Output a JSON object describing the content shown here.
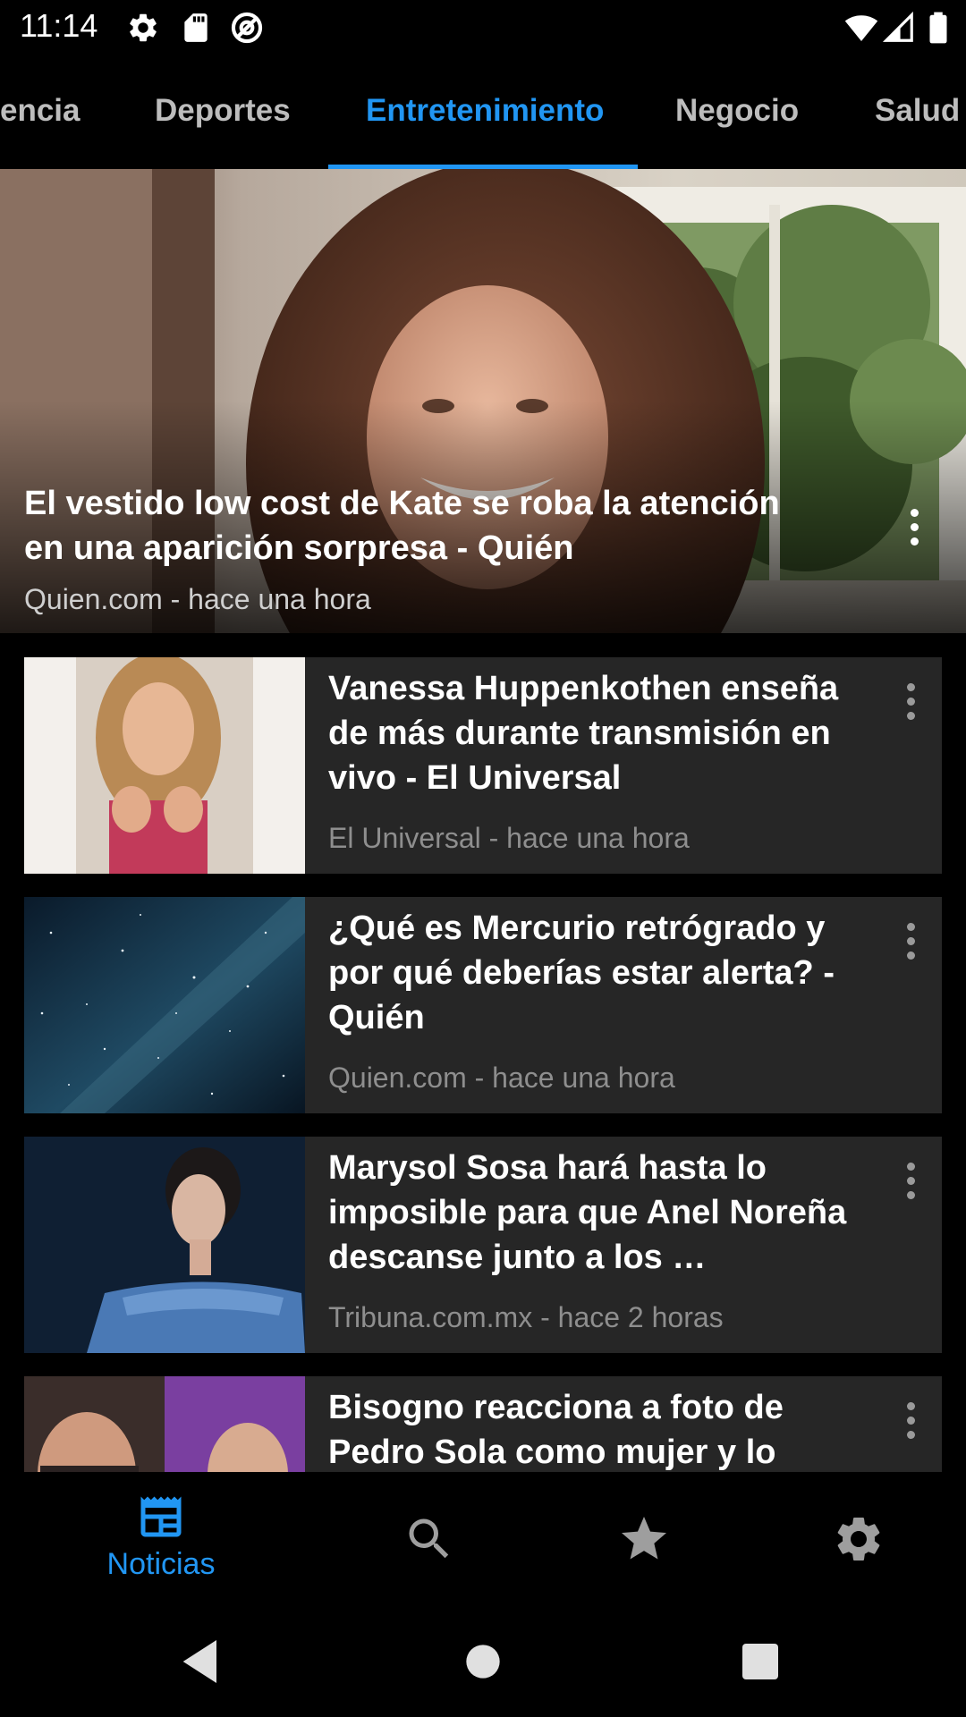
{
  "status_bar": {
    "time": "11:14",
    "icons": [
      "settings-gear-icon",
      "sd-card-icon",
      "at-sign-icon",
      "wifi-icon",
      "signal-icon",
      "battery-icon"
    ]
  },
  "tabs": [
    {
      "label": "encia",
      "active": false
    },
    {
      "label": "Deportes",
      "active": false
    },
    {
      "label": "Entretenimiento",
      "active": true
    },
    {
      "label": "Negocio",
      "active": false
    },
    {
      "label": "Salud",
      "active": false
    }
  ],
  "featured": {
    "title": "El vestido low cost de Kate se roba la atención en una aparición sorpresa - Quién",
    "meta": "Quien.com - hace una hora"
  },
  "articles": [
    {
      "title": "Vanessa Huppenkothen enseña de más durante transmisión en vivo - El Universal",
      "meta": "El Universal - hace una hora"
    },
    {
      "title": "¿Qué es Mercurio retrógrado y por qué deberías estar alerta? - Quién",
      "meta": "Quien.com - hace una hora"
    },
    {
      "title": "Marysol Sosa hará hasta lo imposible para que Anel Noreña descanse junto a los …",
      "meta": "Tribuna.com.mx - hace 2 horas"
    },
    {
      "title": "Bisogno reacciona a foto de Pedro Sola como mujer y lo",
      "meta": ""
    }
  ],
  "bottom_nav": {
    "items": [
      {
        "label": "Noticias",
        "icon": "news-icon",
        "active": true
      },
      {
        "label": "",
        "icon": "search-icon",
        "active": false
      },
      {
        "label": "",
        "icon": "star-icon",
        "active": false
      },
      {
        "label": "",
        "icon": "settings-icon",
        "active": false
      }
    ]
  },
  "colors": {
    "accent": "#2196f3",
    "background": "#000000",
    "card": "#262626",
    "meta_text": "#8e8e8e"
  }
}
